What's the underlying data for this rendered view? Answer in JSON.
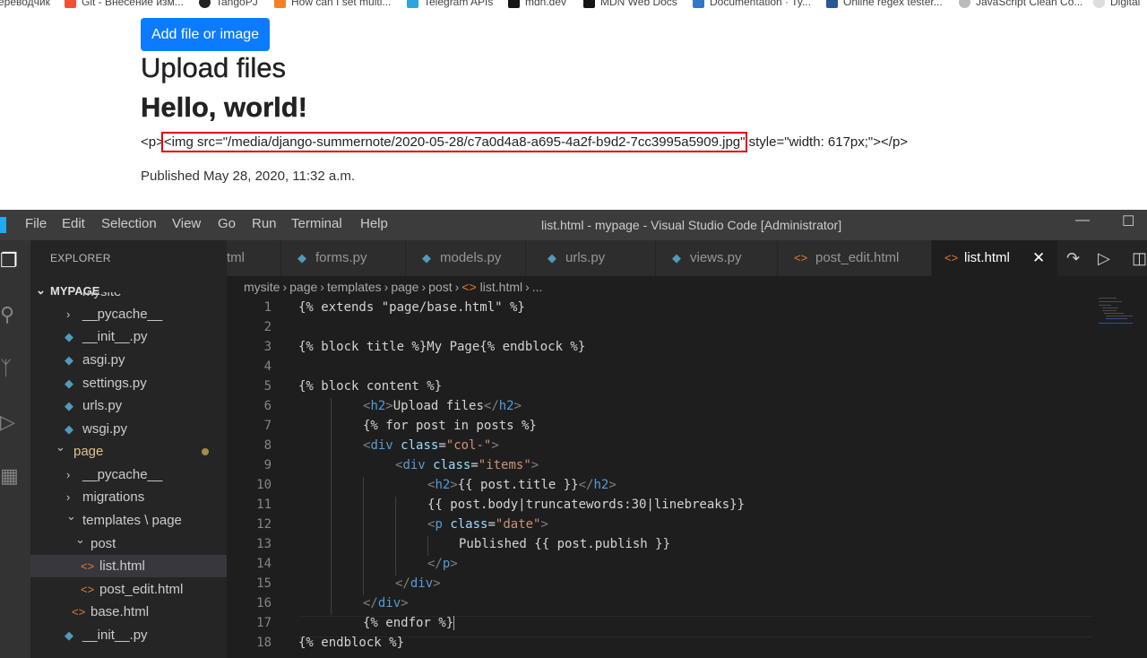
{
  "bookmarks": [
    {
      "label": "ереводчик",
      "icon": "bookmark-icon"
    },
    {
      "label": "Git - Внесение изм...",
      "icon": "git-icon"
    },
    {
      "label": "TangoPJ",
      "icon": "github-icon"
    },
    {
      "label": "How can I set multi...",
      "icon": "stackoverflow-icon"
    },
    {
      "label": "Telegram APIs",
      "icon": "telegram-icon"
    },
    {
      "label": "mdn.dev",
      "icon": "mdn-icon"
    },
    {
      "label": "MDN Web Docs",
      "icon": "mdn-icon"
    },
    {
      "label": "Documentation · Ty...",
      "icon": "typescript-icon"
    },
    {
      "label": "Online regex tester...",
      "icon": "regex-icon"
    },
    {
      "label": "JavaScript Clean Co...",
      "icon": "js-icon"
    },
    {
      "label": "Digital",
      "icon": "globe-icon"
    }
  ],
  "webpage": {
    "add_button": "Add file or image",
    "heading_upload": "Upload files",
    "heading_post": "Hello, world!",
    "raw_before": "<p>",
    "raw_highlight": "<img src=\"/media/django-summernote/2020-05-28/c7a0d4a8-a695-4a2f-b9d2-7cc3995a5909.jpg\"",
    "raw_after": " style=\"width: 617px;\"></p>",
    "published": "Published May 28, 2020, 11:32 a.m."
  },
  "vscode": {
    "menu": [
      "File",
      "Edit",
      "Selection",
      "View",
      "Go",
      "Run",
      "Terminal",
      "Help"
    ],
    "window_title": "list.html - mypage - Visual Studio Code [Administrator]",
    "explorer_title": "EXPLORER",
    "project": "MYPAGE",
    "tree": [
      {
        "label": "mysite",
        "type": "folder-open",
        "depth": 1
      },
      {
        "label": "__pycache__",
        "type": "folder",
        "depth": 2
      },
      {
        "label": "__init__.py",
        "type": "py",
        "depth": 2
      },
      {
        "label": "asgi.py",
        "type": "py",
        "depth": 2
      },
      {
        "label": "settings.py",
        "type": "py",
        "depth": 2
      },
      {
        "label": "urls.py",
        "type": "py",
        "depth": 2
      },
      {
        "label": "wsgi.py",
        "type": "py",
        "depth": 2
      },
      {
        "label": "page",
        "type": "folder-open",
        "depth": 1,
        "modified": true
      },
      {
        "label": "__pycache__",
        "type": "folder",
        "depth": 2
      },
      {
        "label": "migrations",
        "type": "folder",
        "depth": 2
      },
      {
        "label": "templates \\ page",
        "type": "folder-open",
        "depth": 2
      },
      {
        "label": "post",
        "type": "folder-open",
        "depth": 3
      },
      {
        "label": "list.html",
        "type": "html",
        "depth": 4,
        "active": true
      },
      {
        "label": "post_edit.html",
        "type": "html",
        "depth": 4
      },
      {
        "label": "base.html",
        "type": "html",
        "depth": 3
      },
      {
        "label": "__init__.py",
        "type": "py",
        "depth": 2
      }
    ],
    "tabs": [
      {
        "label": "tml",
        "type": "html"
      },
      {
        "label": "forms.py",
        "type": "py"
      },
      {
        "label": "models.py",
        "type": "py"
      },
      {
        "label": "urls.py",
        "type": "py"
      },
      {
        "label": "views.py",
        "type": "py"
      },
      {
        "label": "post_edit.html",
        "type": "html"
      },
      {
        "label": "list.html",
        "type": "html",
        "active": true
      }
    ],
    "breadcrumbs": [
      "mysite",
      "page",
      "templates",
      "page",
      "post",
      "list.html",
      "..."
    ],
    "line_numbers": [
      "1",
      "2",
      "3",
      "4",
      "5",
      "6",
      "7",
      "8",
      "9",
      "10",
      "11",
      "12",
      "13",
      "14",
      "15",
      "16",
      "17",
      "18"
    ],
    "code": {
      "l1": "{% extends \"page/base.html\" %}",
      "l3": "{% block title %}My Page{% endblock %}",
      "l5": "{% block content %}",
      "l6_tag": "h2",
      "l6_text": "Upload files",
      "l7": "{% for post in posts %}",
      "l8_tag": "div",
      "l8_attr": "class",
      "l8_val": "\"col-\"",
      "l9_tag": "div",
      "l9_attr": "class",
      "l9_val": "\"items\"",
      "l10_tag": "h2",
      "l10_text": "{{ post.title }}",
      "l11": "{{ post.body|truncatewords:30|linebreaks}}",
      "l12_tag": "p",
      "l12_attr": "class",
      "l12_val": "\"date\"",
      "l13": "Published {{ post.publish }}",
      "l14_tag": "p",
      "l15_tag": "div",
      "l16_tag": "div",
      "l17": "{% endfor %}",
      "l18": "{% endblock %}"
    }
  }
}
